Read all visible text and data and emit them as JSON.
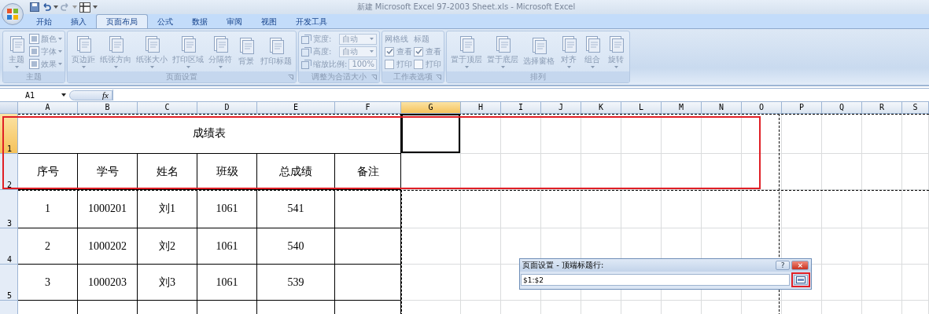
{
  "window": {
    "title": "新建 Microsoft Excel 97-2003 Sheet.xls - Microsoft Excel"
  },
  "tabs": [
    {
      "label": "开始",
      "selected": false
    },
    {
      "label": "插入",
      "selected": false
    },
    {
      "label": "页面布局",
      "selected": true
    },
    {
      "label": "公式",
      "selected": false
    },
    {
      "label": "数据",
      "selected": false
    },
    {
      "label": "审阅",
      "selected": false
    },
    {
      "label": "视图",
      "selected": false
    },
    {
      "label": "开发工具",
      "selected": false
    }
  ],
  "ribbon": {
    "disabled": true,
    "groups": [
      {
        "label": "主题",
        "launcher": false,
        "columns": [
          [
            {
              "kind": "large",
              "label": "主题",
              "dropdown": true
            }
          ],
          [
            {
              "kind": "small",
              "label": "颜色"
            },
            {
              "kind": "small",
              "label": "字体"
            },
            {
              "kind": "small",
              "label": "效果"
            }
          ]
        ]
      },
      {
        "label": "页面设置",
        "launcher": true,
        "columns": [
          [
            {
              "kind": "large",
              "label": "页边距",
              "dropdown": true
            }
          ],
          [
            {
              "kind": "large",
              "label": "纸张方向",
              "dropdown": true
            }
          ],
          [
            {
              "kind": "large",
              "label": "纸张大小",
              "dropdown": true
            }
          ],
          [
            {
              "kind": "large",
              "label": "打印区域",
              "dropdown": true
            }
          ],
          [
            {
              "kind": "large",
              "label": "分隔符",
              "dropdown": true
            }
          ],
          [
            {
              "kind": "large",
              "label": "背景",
              "dropdown": false
            }
          ],
          [
            {
              "kind": "large",
              "label": "打印标题",
              "dropdown": false
            }
          ]
        ]
      },
      {
        "label": "调整为合适大小",
        "launcher": true,
        "columns": [
          [
            {
              "kind": "field",
              "label": "宽度:",
              "value": "自动"
            },
            {
              "kind": "field",
              "label": "高度:",
              "value": "自动"
            },
            {
              "kind": "spin",
              "label": "缩放比例:",
              "value": "100%"
            }
          ]
        ]
      },
      {
        "label": "工作表选项",
        "launcher": true,
        "columns": [
          [
            {
              "kind": "heading",
              "label": "网格线"
            },
            {
              "kind": "check",
              "label": "查看",
              "checked": true
            },
            {
              "kind": "check",
              "label": "打印",
              "checked": false
            }
          ],
          [
            {
              "kind": "heading",
              "label": "标题"
            },
            {
              "kind": "check",
              "label": "查看",
              "checked": true
            },
            {
              "kind": "check",
              "label": "打印",
              "checked": false
            }
          ]
        ]
      },
      {
        "label": "排列",
        "launcher": false,
        "columns": [
          [
            {
              "kind": "large",
              "label": "置于顶层",
              "dropdown": true
            }
          ],
          [
            {
              "kind": "large",
              "label": "置于底层",
              "dropdown": true
            }
          ],
          [
            {
              "kind": "large",
              "label": "选择窗格",
              "dropdown": false
            }
          ],
          [
            {
              "kind": "large",
              "label": "对齐",
              "dropdown": true
            }
          ],
          [
            {
              "kind": "large",
              "label": "组合",
              "dropdown": true
            }
          ],
          [
            {
              "kind": "large",
              "label": "旋转",
              "dropdown": true
            }
          ]
        ]
      }
    ]
  },
  "formula_bar": {
    "name_box": "A1",
    "fx": "fx"
  },
  "columns": [
    {
      "label": "A",
      "selected": false
    },
    {
      "label": "B",
      "selected": false
    },
    {
      "label": "C",
      "selected": false
    },
    {
      "label": "D",
      "selected": false
    },
    {
      "label": "E",
      "selected": false
    },
    {
      "label": "F",
      "selected": false
    },
    {
      "label": "G",
      "selected": true
    },
    {
      "label": "H",
      "selected": false
    },
    {
      "label": "I",
      "selected": false
    },
    {
      "label": "J",
      "selected": false
    },
    {
      "label": "K",
      "selected": false
    },
    {
      "label": "L",
      "selected": false
    },
    {
      "label": "M",
      "selected": false
    },
    {
      "label": "N",
      "selected": false
    },
    {
      "label": "O",
      "selected": false
    },
    {
      "label": "P",
      "selected": false
    },
    {
      "label": "Q",
      "selected": false
    },
    {
      "label": "R",
      "selected": false
    },
    {
      "label": "S",
      "selected": false
    }
  ],
  "rows": [
    {
      "label": "1",
      "selected": true
    },
    {
      "label": "2",
      "selected": false
    },
    {
      "label": "3",
      "selected": false
    },
    {
      "label": "4",
      "selected": false
    },
    {
      "label": "5",
      "selected": false
    }
  ],
  "table": {
    "title": "成绩表",
    "header": [
      "序号",
      "学号",
      "姓名",
      "班级",
      "总成绩",
      "备注"
    ],
    "rows": [
      [
        "1",
        "1000201",
        "刘1",
        "1061",
        "541"
      ],
      [
        "2",
        "1000202",
        "刘2",
        "1061",
        "540"
      ],
      [
        "3",
        "1000203",
        "刘3",
        "1061",
        "539"
      ]
    ]
  },
  "dialog": {
    "title": "页面设置 - 顶端标题行:",
    "help": "?",
    "close": "×",
    "value": "$1:$2"
  }
}
